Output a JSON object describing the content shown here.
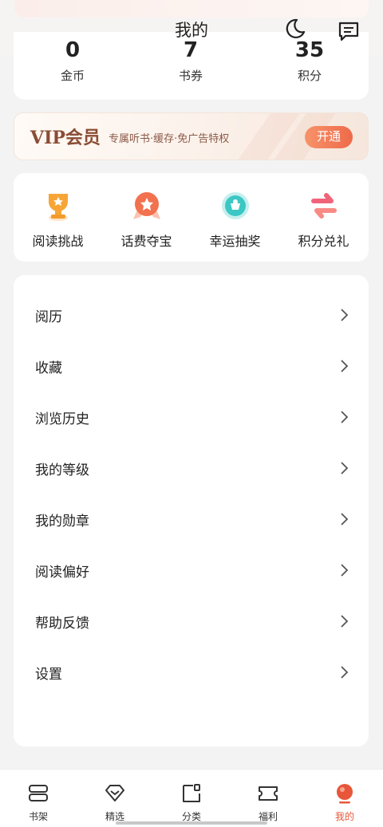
{
  "header": {
    "title": "我的"
  },
  "stats": [
    {
      "value": "0",
      "label": "金币"
    },
    {
      "value": "7",
      "label": "书券"
    },
    {
      "value": "35",
      "label": "积分"
    }
  ],
  "vip": {
    "title": "VIP会员",
    "desc": "专属听书·缓存·免广告特权",
    "button": "开通"
  },
  "tools": [
    {
      "label": "阅读挑战",
      "icon": "trophy-icon"
    },
    {
      "label": "话费夺宝",
      "icon": "badge-star-icon"
    },
    {
      "label": "幸运抽奖",
      "icon": "lucky-draw-icon"
    },
    {
      "label": "积分兑礼",
      "icon": "exchange-icon"
    }
  ],
  "menu": [
    {
      "label": "阅历"
    },
    {
      "label": "收藏"
    },
    {
      "label": "浏览历史"
    },
    {
      "label": "我的等级"
    },
    {
      "label": "我的勋章"
    },
    {
      "label": "阅读偏好"
    },
    {
      "label": "帮助反馈"
    },
    {
      "label": "设置"
    }
  ],
  "tabs": [
    {
      "label": "书架",
      "icon": "bookshelf-icon"
    },
    {
      "label": "精选",
      "icon": "diamond-icon"
    },
    {
      "label": "分类",
      "icon": "category-icon"
    },
    {
      "label": "福利",
      "icon": "ticket-icon"
    },
    {
      "label": "我的",
      "icon": "profile-icon"
    }
  ],
  "colors": {
    "accent": "#e8563a",
    "vip_text": "#8a4d34"
  }
}
